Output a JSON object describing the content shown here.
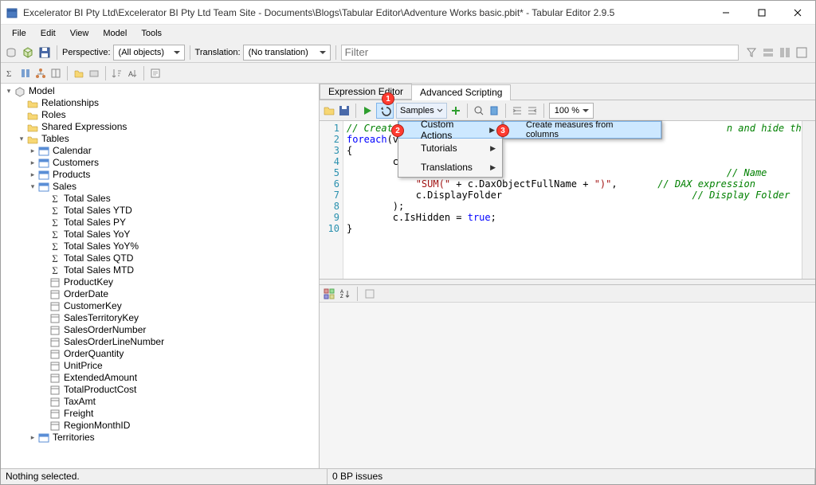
{
  "window": {
    "title": "Excelerator BI Pty Ltd\\Excelerator BI Pty Ltd Team Site - Documents\\Blogs\\Tabular Editor\\Adventure Works basic.pbit* - Tabular Editor 2.9.5"
  },
  "menubar": [
    "File",
    "Edit",
    "View",
    "Model",
    "Tools"
  ],
  "toolbar1": {
    "perspective_label": "Perspective:",
    "perspective_value": "(All objects)",
    "translation_label": "Translation:",
    "translation_value": "(No translation)",
    "filter_placeholder": "Filter"
  },
  "tree": {
    "root": "Model",
    "folders": [
      "Relationships",
      "Roles",
      "Shared Expressions"
    ],
    "tables_label": "Tables",
    "tables": [
      "Calendar",
      "Customers",
      "Products"
    ],
    "sales_label": "Sales",
    "sales_measures": [
      "Total Sales",
      "Total Sales YTD",
      "Total Sales PY",
      "Total Sales YoY",
      "Total Sales YoY%",
      "Total Sales QTD",
      "Total Sales MTD"
    ],
    "sales_columns": [
      "ProductKey",
      "OrderDate",
      "CustomerKey",
      "SalesTerritoryKey",
      "SalesOrderNumber",
      "SalesOrderLineNumber",
      "OrderQuantity",
      "UnitPrice",
      "ExtendedAmount",
      "TotalProductCost",
      "TaxAmt",
      "Freight",
      "RegionMonthID"
    ],
    "territories_label": "Territories"
  },
  "tabs": {
    "expression": "Expression Editor",
    "advanced": "Advanced Scripting"
  },
  "script_toolbar": {
    "samples": "Samples",
    "zoom": "100 %"
  },
  "samples_menu": {
    "custom_actions": "Custom Actions",
    "tutorials": "Tutorials",
    "translations": "Translations",
    "create_measures": "Create measures from columns"
  },
  "code": {
    "l1a": "// Create",
    "l1b": "n and hide the column.",
    "l2a": "foreach",
    "l2b": "(v",
    "l4": "        c.Tab",
    "l5a": "            \"",
    "l5b": "// Name",
    "l6a": "            ",
    "l6b": "\"SUM(\"",
    "l6c": " + c.DaxObjectFullName + ",
    "l6d": "\")\"",
    "l6e": ",",
    "l6f": "// DAX expression",
    "l7a": "            c.DisplayFolder",
    "l7b": "// Display Folder",
    "l8": "        );",
    "l9a": "        c.IsHidden = ",
    "l9b": "true",
    "l9c": ";"
  },
  "status": {
    "selection": "Nothing selected.",
    "bp": "0 BP issues"
  }
}
